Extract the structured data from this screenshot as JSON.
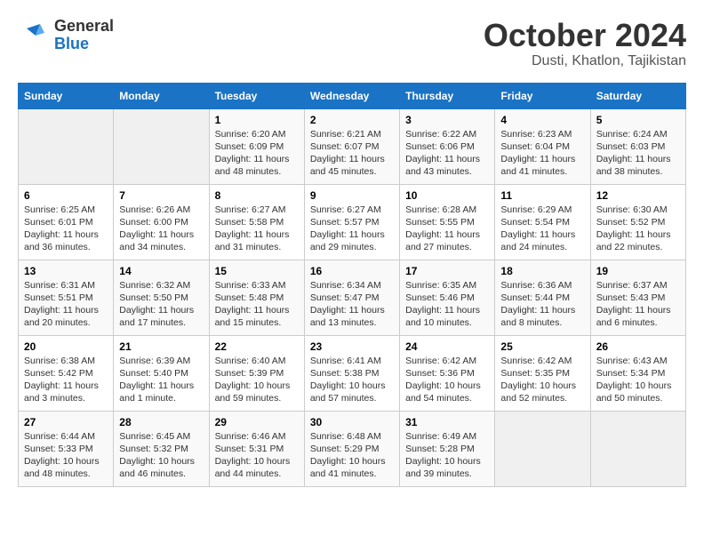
{
  "header": {
    "logo_line1": "General",
    "logo_line2": "Blue",
    "month_title": "October 2024",
    "location": "Dusti, Khatlon, Tajikistan"
  },
  "days_of_week": [
    "Sunday",
    "Monday",
    "Tuesday",
    "Wednesday",
    "Thursday",
    "Friday",
    "Saturday"
  ],
  "weeks": [
    [
      {
        "day": "",
        "empty": true
      },
      {
        "day": "",
        "empty": true
      },
      {
        "day": "1",
        "sunrise": "Sunrise: 6:20 AM",
        "sunset": "Sunset: 6:09 PM",
        "daylight": "Daylight: 11 hours and 48 minutes."
      },
      {
        "day": "2",
        "sunrise": "Sunrise: 6:21 AM",
        "sunset": "Sunset: 6:07 PM",
        "daylight": "Daylight: 11 hours and 45 minutes."
      },
      {
        "day": "3",
        "sunrise": "Sunrise: 6:22 AM",
        "sunset": "Sunset: 6:06 PM",
        "daylight": "Daylight: 11 hours and 43 minutes."
      },
      {
        "day": "4",
        "sunrise": "Sunrise: 6:23 AM",
        "sunset": "Sunset: 6:04 PM",
        "daylight": "Daylight: 11 hours and 41 minutes."
      },
      {
        "day": "5",
        "sunrise": "Sunrise: 6:24 AM",
        "sunset": "Sunset: 6:03 PM",
        "daylight": "Daylight: 11 hours and 38 minutes."
      }
    ],
    [
      {
        "day": "6",
        "sunrise": "Sunrise: 6:25 AM",
        "sunset": "Sunset: 6:01 PM",
        "daylight": "Daylight: 11 hours and 36 minutes."
      },
      {
        "day": "7",
        "sunrise": "Sunrise: 6:26 AM",
        "sunset": "Sunset: 6:00 PM",
        "daylight": "Daylight: 11 hours and 34 minutes."
      },
      {
        "day": "8",
        "sunrise": "Sunrise: 6:27 AM",
        "sunset": "Sunset: 5:58 PM",
        "daylight": "Daylight: 11 hours and 31 minutes."
      },
      {
        "day": "9",
        "sunrise": "Sunrise: 6:27 AM",
        "sunset": "Sunset: 5:57 PM",
        "daylight": "Daylight: 11 hours and 29 minutes."
      },
      {
        "day": "10",
        "sunrise": "Sunrise: 6:28 AM",
        "sunset": "Sunset: 5:55 PM",
        "daylight": "Daylight: 11 hours and 27 minutes."
      },
      {
        "day": "11",
        "sunrise": "Sunrise: 6:29 AM",
        "sunset": "Sunset: 5:54 PM",
        "daylight": "Daylight: 11 hours and 24 minutes."
      },
      {
        "day": "12",
        "sunrise": "Sunrise: 6:30 AM",
        "sunset": "Sunset: 5:52 PM",
        "daylight": "Daylight: 11 hours and 22 minutes."
      }
    ],
    [
      {
        "day": "13",
        "sunrise": "Sunrise: 6:31 AM",
        "sunset": "Sunset: 5:51 PM",
        "daylight": "Daylight: 11 hours and 20 minutes."
      },
      {
        "day": "14",
        "sunrise": "Sunrise: 6:32 AM",
        "sunset": "Sunset: 5:50 PM",
        "daylight": "Daylight: 11 hours and 17 minutes."
      },
      {
        "day": "15",
        "sunrise": "Sunrise: 6:33 AM",
        "sunset": "Sunset: 5:48 PM",
        "daylight": "Daylight: 11 hours and 15 minutes."
      },
      {
        "day": "16",
        "sunrise": "Sunrise: 6:34 AM",
        "sunset": "Sunset: 5:47 PM",
        "daylight": "Daylight: 11 hours and 13 minutes."
      },
      {
        "day": "17",
        "sunrise": "Sunrise: 6:35 AM",
        "sunset": "Sunset: 5:46 PM",
        "daylight": "Daylight: 11 hours and 10 minutes."
      },
      {
        "day": "18",
        "sunrise": "Sunrise: 6:36 AM",
        "sunset": "Sunset: 5:44 PM",
        "daylight": "Daylight: 11 hours and 8 minutes."
      },
      {
        "day": "19",
        "sunrise": "Sunrise: 6:37 AM",
        "sunset": "Sunset: 5:43 PM",
        "daylight": "Daylight: 11 hours and 6 minutes."
      }
    ],
    [
      {
        "day": "20",
        "sunrise": "Sunrise: 6:38 AM",
        "sunset": "Sunset: 5:42 PM",
        "daylight": "Daylight: 11 hours and 3 minutes."
      },
      {
        "day": "21",
        "sunrise": "Sunrise: 6:39 AM",
        "sunset": "Sunset: 5:40 PM",
        "daylight": "Daylight: 11 hours and 1 minute."
      },
      {
        "day": "22",
        "sunrise": "Sunrise: 6:40 AM",
        "sunset": "Sunset: 5:39 PM",
        "daylight": "Daylight: 10 hours and 59 minutes."
      },
      {
        "day": "23",
        "sunrise": "Sunrise: 6:41 AM",
        "sunset": "Sunset: 5:38 PM",
        "daylight": "Daylight: 10 hours and 57 minutes."
      },
      {
        "day": "24",
        "sunrise": "Sunrise: 6:42 AM",
        "sunset": "Sunset: 5:36 PM",
        "daylight": "Daylight: 10 hours and 54 minutes."
      },
      {
        "day": "25",
        "sunrise": "Sunrise: 6:42 AM",
        "sunset": "Sunset: 5:35 PM",
        "daylight": "Daylight: 10 hours and 52 minutes."
      },
      {
        "day": "26",
        "sunrise": "Sunrise: 6:43 AM",
        "sunset": "Sunset: 5:34 PM",
        "daylight": "Daylight: 10 hours and 50 minutes."
      }
    ],
    [
      {
        "day": "27",
        "sunrise": "Sunrise: 6:44 AM",
        "sunset": "Sunset: 5:33 PM",
        "daylight": "Daylight: 10 hours and 48 minutes."
      },
      {
        "day": "28",
        "sunrise": "Sunrise: 6:45 AM",
        "sunset": "Sunset: 5:32 PM",
        "daylight": "Daylight: 10 hours and 46 minutes."
      },
      {
        "day": "29",
        "sunrise": "Sunrise: 6:46 AM",
        "sunset": "Sunset: 5:31 PM",
        "daylight": "Daylight: 10 hours and 44 minutes."
      },
      {
        "day": "30",
        "sunrise": "Sunrise: 6:48 AM",
        "sunset": "Sunset: 5:29 PM",
        "daylight": "Daylight: 10 hours and 41 minutes."
      },
      {
        "day": "31",
        "sunrise": "Sunrise: 6:49 AM",
        "sunset": "Sunset: 5:28 PM",
        "daylight": "Daylight: 10 hours and 39 minutes."
      },
      {
        "day": "",
        "empty": true
      },
      {
        "day": "",
        "empty": true
      }
    ]
  ]
}
